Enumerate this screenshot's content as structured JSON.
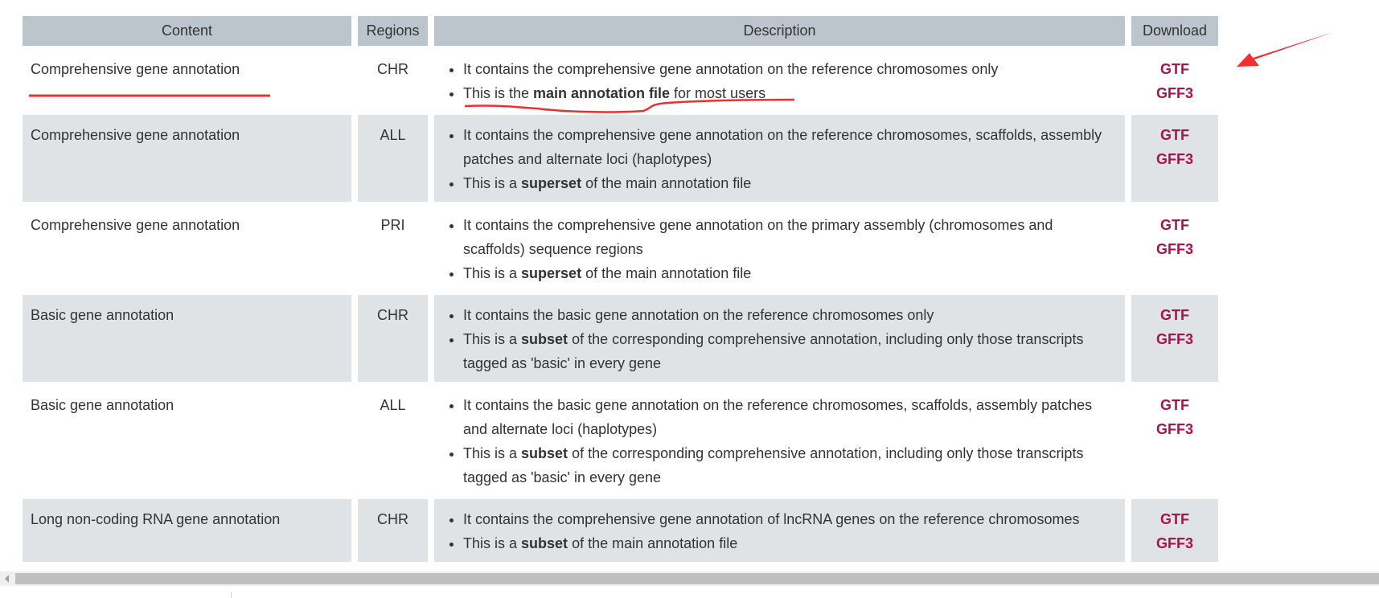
{
  "headers": [
    "Content",
    "Regions",
    "Description",
    "Download"
  ],
  "rows": [
    {
      "content": "Comprehensive gene annotation",
      "region": "CHR",
      "desc": [
        [
          {
            "t": "It contains the comprehensive gene annotation on the reference chromosomes only"
          }
        ],
        [
          {
            "t": "This is the "
          },
          {
            "t": "main annotation file",
            "b": true
          },
          {
            "t": " for most users"
          }
        ]
      ],
      "links": [
        "GTF",
        "GFF3"
      ]
    },
    {
      "content": "Comprehensive gene annotation",
      "region": "ALL",
      "desc": [
        [
          {
            "t": "It contains the comprehensive gene annotation on the reference chromosomes, scaffolds, assembly patches and alternate loci (haplotypes)"
          }
        ],
        [
          {
            "t": "This is a "
          },
          {
            "t": "superset",
            "b": true
          },
          {
            "t": " of the main annotation file"
          }
        ]
      ],
      "links": [
        "GTF",
        "GFF3"
      ]
    },
    {
      "content": "Comprehensive gene annotation",
      "region": "PRI",
      "desc": [
        [
          {
            "t": "It contains the comprehensive gene annotation on the primary assembly (chromosomes and scaffolds) sequence regions"
          }
        ],
        [
          {
            "t": "This is a "
          },
          {
            "t": "superset",
            "b": true
          },
          {
            "t": " of the main annotation file"
          }
        ]
      ],
      "links": [
        "GTF",
        "GFF3"
      ]
    },
    {
      "content": "Basic gene annotation",
      "region": "CHR",
      "desc": [
        [
          {
            "t": "It contains the basic gene annotation on the reference chromosomes only"
          }
        ],
        [
          {
            "t": "This is a "
          },
          {
            "t": "subset",
            "b": true
          },
          {
            "t": " of the corresponding comprehensive annotation, including only those transcripts tagged as 'basic' in every gene"
          }
        ]
      ],
      "links": [
        "GTF",
        "GFF3"
      ]
    },
    {
      "content": "Basic gene annotation",
      "region": "ALL",
      "desc": [
        [
          {
            "t": "It contains the basic gene annotation on the reference chromosomes, scaffolds, assembly patches and alternate loci (haplotypes)"
          }
        ],
        [
          {
            "t": "This is a "
          },
          {
            "t": "subset",
            "b": true
          },
          {
            "t": " of the corresponding comprehensive annotation, including only those transcripts tagged as 'basic' in every gene"
          }
        ]
      ],
      "links": [
        "GTF",
        "GFF3"
      ]
    },
    {
      "content": "Long non-coding RNA gene annotation",
      "region": "CHR",
      "desc": [
        [
          {
            "t": "It contains the comprehensive gene annotation of lncRNA genes on the reference chromosomes"
          }
        ],
        [
          {
            "t": "This is a "
          },
          {
            "t": "subset",
            "b": true
          },
          {
            "t": " of the main annotation file"
          }
        ]
      ],
      "links": [
        "GTF",
        "GFF3"
      ]
    }
  ],
  "colors": {
    "header_bg": "#bdc5cc",
    "alt_row_bg": "#dfe3e6",
    "link": "#a8124f",
    "annotation": "#f03030"
  }
}
